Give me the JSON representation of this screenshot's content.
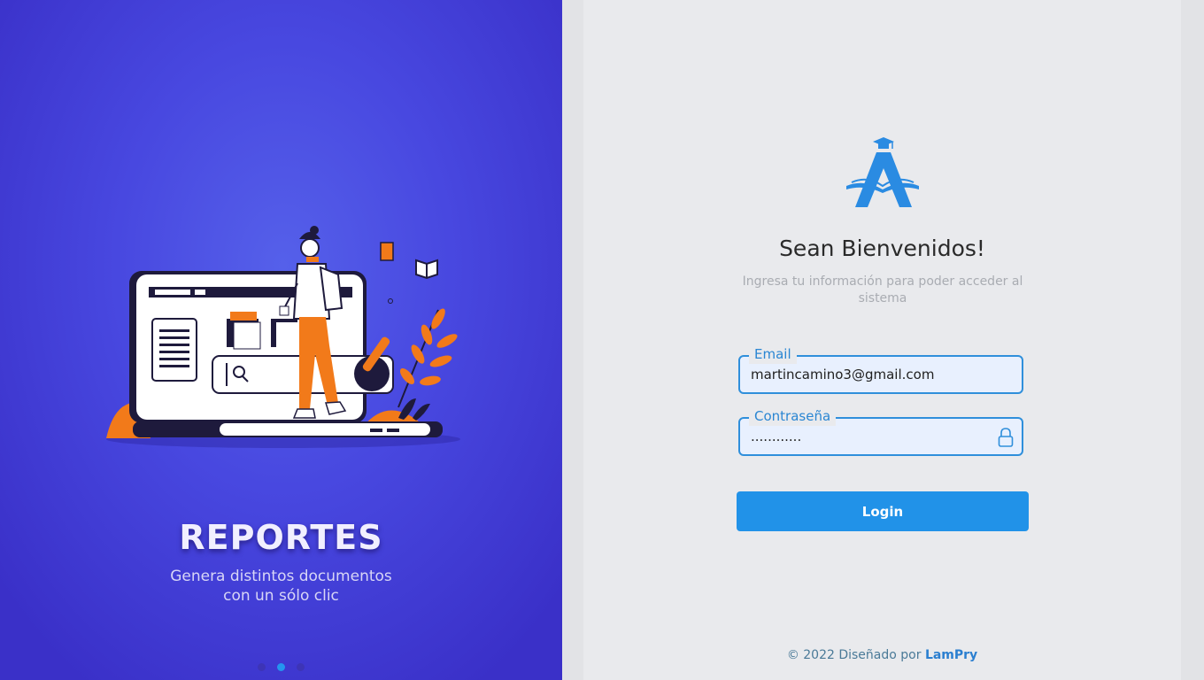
{
  "slide": {
    "title": "REPORTES",
    "subtitle_line1": "Genera distintos documentos",
    "subtitle_line2": "con un sólo clic",
    "dots_count": 3,
    "active_dot": 2
  },
  "login": {
    "welcome": "Sean Bienvenidos!",
    "subtitle": "Ingresa tu información para poder acceder al sistema",
    "email_label": "Email",
    "email_value": "martincamino3@gmail.com",
    "password_label": "Contraseña",
    "password_value": "............",
    "submit_label": "Login"
  },
  "footer": {
    "copyright": "© 2022 Diseñado por",
    "author": "LamPry"
  },
  "colors": {
    "accent": "#2192e8",
    "panel_bg": "#4848e0",
    "orange": "#f27a1a"
  }
}
